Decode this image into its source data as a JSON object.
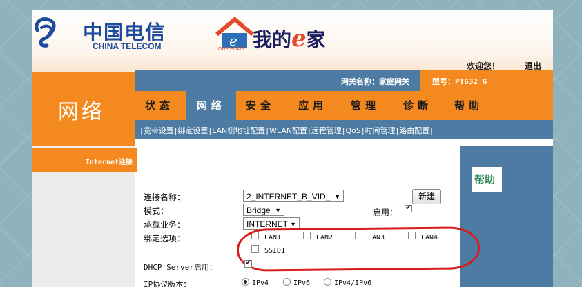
{
  "branding": {
    "telecom_cn": "中国电信",
    "telecom_en": "CHINA TELECOM",
    "ehome_title_prefix": "我的",
    "ehome_title_e": "e",
    "ehome_title_suffix": "家",
    "ehome_tag": "ONE HOME"
  },
  "header": {
    "welcome": "欢迎您！",
    "logout": "退出",
    "gateway_name": "网关名称：家庭网关",
    "model": "型号：PT632 G",
    "page_heading": "网络"
  },
  "nav": {
    "items": [
      {
        "label": "状态",
        "active": false
      },
      {
        "label": "网络",
        "active": true
      },
      {
        "label": "安全",
        "active": false
      },
      {
        "label": "应用",
        "active": false
      },
      {
        "label": "管理",
        "active": false
      },
      {
        "label": "诊断",
        "active": false
      },
      {
        "label": "帮助",
        "active": false
      }
    ]
  },
  "subnav": {
    "items": [
      "宽带设置",
      "绑定设置",
      "LAN侧地址配置",
      "WLAN配置",
      "远程管理",
      "QoS",
      "时间管理",
      "路由配置"
    ]
  },
  "sidebar": {
    "active_item": "Internet连接"
  },
  "help": {
    "title": "帮助"
  },
  "form": {
    "connection_name_label": "连接名称：",
    "connection_name_value": "2_INTERNET_B_VID_",
    "new_button": "新建",
    "mode_label": "模式：",
    "mode_value": "Bridge",
    "enable_label": "启用：",
    "enabled": true,
    "service_label": "承载业务：",
    "service_value": "INTERNET",
    "bind_label": "绑定选项：",
    "bind_options": [
      {
        "label": "LAN1",
        "checked": false
      },
      {
        "label": "LAN2",
        "checked": false
      },
      {
        "label": "LAN3",
        "checked": false
      },
      {
        "label": "LAN4",
        "checked": false
      },
      {
        "label": "SSID1",
        "checked": false
      }
    ],
    "dhcp_label": "DHCP Server启用：",
    "dhcp_enabled": true,
    "ip_version_label": "IP协议版本：",
    "ip_versions": [
      {
        "label": "IPv4",
        "selected": true
      },
      {
        "label": "IPv6",
        "selected": false
      },
      {
        "label": "IPv4/IPv6",
        "selected": false
      }
    ]
  },
  "colors": {
    "orange": "#f3891f",
    "blue": "#4d7ba3",
    "highlight": "#d81c1c"
  }
}
